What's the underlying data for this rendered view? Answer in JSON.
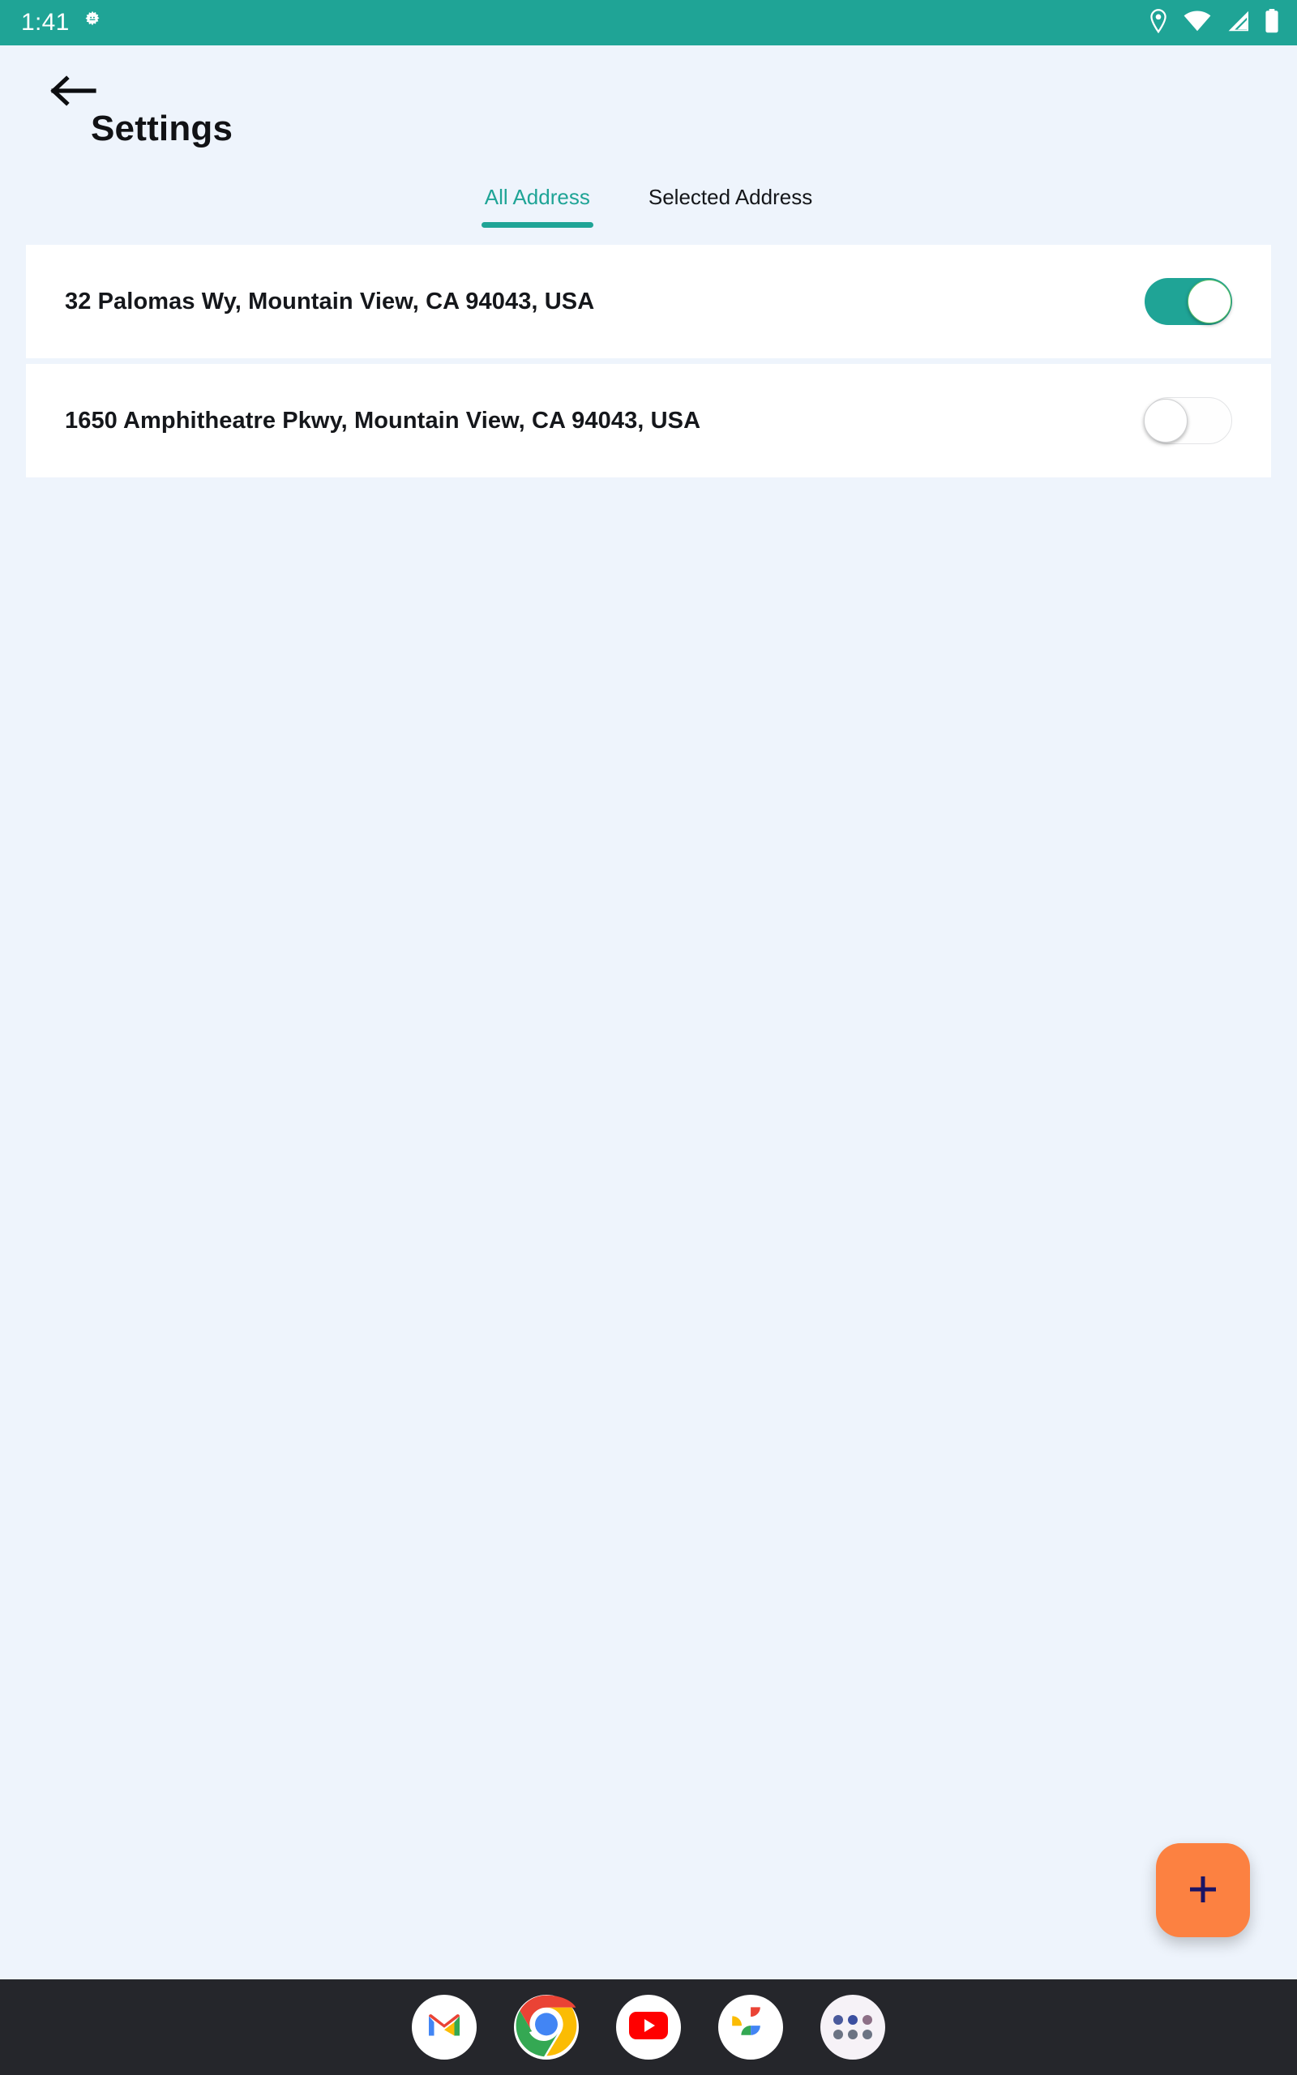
{
  "status_bar": {
    "clock": "1:41",
    "left_icons": [
      "android-gear-icon"
    ],
    "right_icons": [
      "location-pin-icon",
      "wifi-icon",
      "cellular-signal-icon",
      "battery-icon"
    ],
    "background_color": "#1fa496",
    "foreground_color": "#ffffff"
  },
  "app_bar": {
    "back_icon": "back-arrow-icon",
    "title": "Settings"
  },
  "tabs": {
    "items": [
      {
        "label": "All Address",
        "active": true
      },
      {
        "label": "Selected Address",
        "active": false
      }
    ],
    "active_color": "#1fa496",
    "inactive_color": "#14161a"
  },
  "address_list": {
    "rows": [
      {
        "address": "32 Palomas Wy, Mountain View, CA 94043, USA",
        "toggle_state": "on"
      },
      {
        "address": "1650 Amphitheatre Pkwy, Mountain View, CA 94043, USA",
        "toggle_state": "off"
      }
    ]
  },
  "fab": {
    "icon": "plus-icon",
    "background_color": "#fc8141",
    "icon_color": "#1b1464"
  },
  "dock": {
    "background_color": "#25262b",
    "apps": [
      {
        "name": "gmail-icon"
      },
      {
        "name": "chrome-icon"
      },
      {
        "name": "youtube-icon"
      },
      {
        "name": "google-photos-icon"
      },
      {
        "name": "app-drawer-icon"
      }
    ]
  },
  "theme": {
    "page_background": "#eef4fc",
    "card_background": "#ffffff",
    "accent": "#1fa496"
  }
}
